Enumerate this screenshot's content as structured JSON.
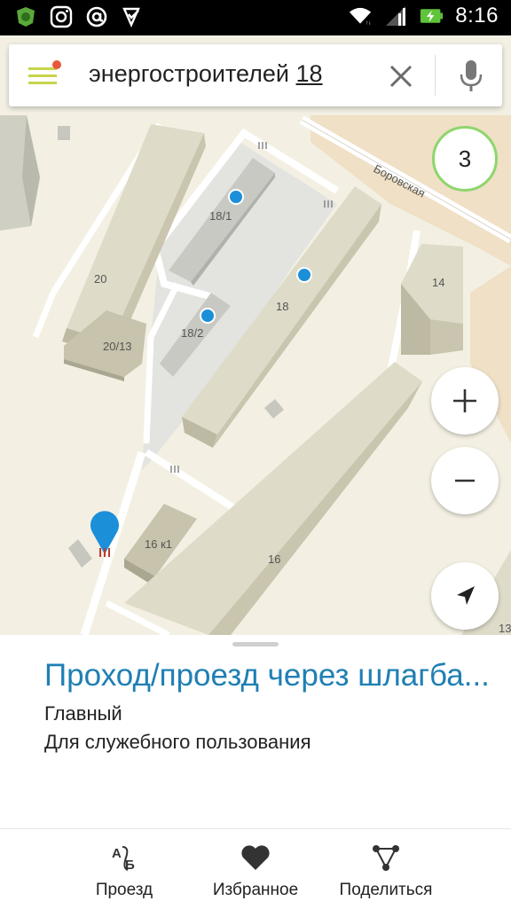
{
  "status_bar": {
    "time": "8:16",
    "icons": [
      "app-badge-icon",
      "instagram-icon",
      "at-sign-icon",
      "checkmark-app-icon",
      "wifi-icon",
      "signal-icon",
      "battery-charging-icon"
    ]
  },
  "search": {
    "query_prefix": "энергостроителей ",
    "query_highlight": "18"
  },
  "map": {
    "cluster_count": "3",
    "street_label": "Боровская",
    "building_labels": {
      "b18_1": "18/1",
      "b20": "20",
      "b20_13": "20/13",
      "b18_2": "18/2",
      "b18": "18",
      "b14": "14",
      "b16k1": "16 к1",
      "b16": "16",
      "b13": "13"
    }
  },
  "poi": {
    "title": "Проход/проезд через шлагба...",
    "line1": "Главный",
    "line2": "Для служебного пользования"
  },
  "bottom_bar": {
    "route_label": "Проезд",
    "favorites_label": "Избранное",
    "share_label": "Поделиться"
  },
  "colors": {
    "accent_green": "#8ed66c",
    "title_blue": "#1f7fb4",
    "marker_blue": "#1c8fd9",
    "menu_yellow": "#c8d44a",
    "menu_dot_red": "#e8583a"
  }
}
